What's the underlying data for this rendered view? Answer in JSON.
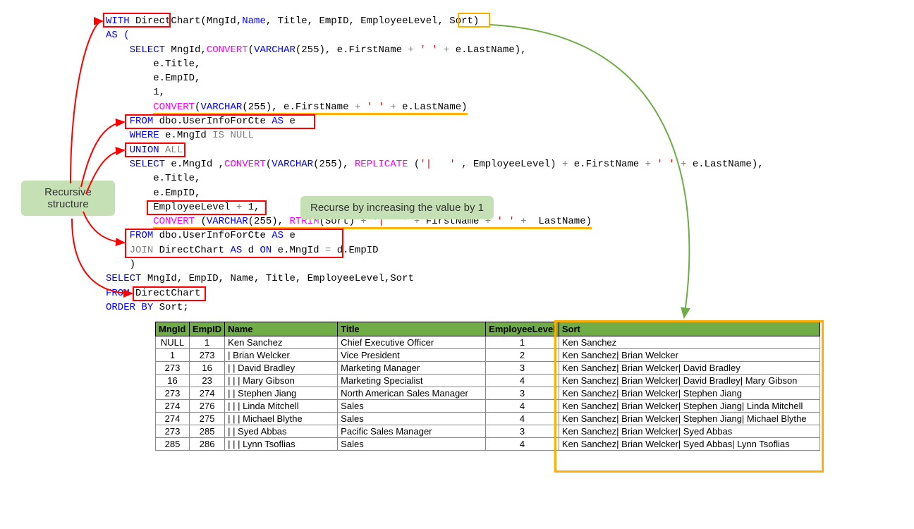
{
  "labels": {
    "recursive_structure": "Recursive\nstructure",
    "recurse_increase": "Recurse by increasing the value by 1"
  },
  "code": {
    "l1_with": "WITH",
    "l1_cte_decl": " DirectChart(",
    "l1_cols": [
      "MngId",
      "Name",
      "Title",
      "EmpID",
      "EmployeeLevel",
      "Sort"
    ],
    "l2": "AS (",
    "l3_select": "SELECT",
    "l3_rest_a": " MngId,",
    "l3_convert": "CONVERT",
    "l3_rest_b": "(",
    "l3_varchar": "VARCHAR",
    "l3_rest_c": "(255), e.FirstName ",
    "l3_plus1": "+",
    "l3_str1": " ' ' ",
    "l3_plus2": "+",
    "l3_rest_d": " e.LastName),",
    "l4": "e.Title,",
    "l5": "e.EmpID,",
    "l6": "1,",
    "l7_convert": "CONVERT",
    "l7_rest_a": "(",
    "l7_varchar": "VARCHAR",
    "l7_rest_b": "(255), e.FirstName ",
    "l7_plus1": "+",
    "l7_str1": " ' ' ",
    "l7_plus2": "+",
    "l7_rest_c": " e.LastName)",
    "l8_from": "FROM",
    "l8_rest": " dbo.UserInfoForCte ",
    "l8_as": "AS",
    "l8_e": " e",
    "l9_where": "WHERE",
    "l9_rest": " e.MngId ",
    "l9_is": "IS",
    "l9_null": " NULL",
    "l10_union": "UNION",
    "l10_all": " ALL",
    "l11_select": "SELECT",
    "l11_rest_a": " e.MngId ,",
    "l11_convert": "CONVERT",
    "l11_rest_b": "(",
    "l11_varchar": "VARCHAR",
    "l11_rest_c": "(255), ",
    "l11_replicate": "REPLICATE ",
    "l11_rest_d": "(",
    "l11_str1": "'|   '",
    "l11_rest_e": " , EmployeeLevel) ",
    "l11_plus1": "+",
    "l11_rest_f": " e.FirstName ",
    "l11_plus2": "+",
    "l11_str2": " ' ' ",
    "l11_plus3": "+",
    "l11_rest_g": " e.LastName),",
    "l12": "e.Title,",
    "l13": "e.EmpID,",
    "l14": "EmployeeLevel ",
    "l14_plus": "+",
    "l14_rest": " 1,",
    "l15_convert": "CONVERT ",
    "l15_rest_a": "(",
    "l15_varchar": "VARCHAR",
    "l15_rest_b": "(255), ",
    "l15_rtrim": "RTRIM",
    "l15_rest_c": "(Sort) ",
    "l15_plus1": "+",
    "l15_str1": " '|   ' ",
    "l15_plus2": "+",
    "l15_rest_d": " FirstName ",
    "l15_plus3": "+",
    "l15_str2": " ' ' ",
    "l15_plus4": "+",
    "l15_rest_e": "  LastName)",
    "l16_from": "FROM",
    "l16_rest_a": " dbo.UserInfoForCte ",
    "l16_as": "AS",
    "l16_rest_b": " e",
    "l17_join": "JOIN",
    "l17_rest_a": " DirectChart ",
    "l17_as": "AS",
    "l17_rest_b": " d ",
    "l17_on": "ON",
    "l17_rest_c": " e.MngId ",
    "l17_eq": "=",
    "l17_rest_d": " d.EmpID",
    "l18": ")",
    "l19_select": "SELECT",
    "l19_rest": " MngId, EmpID, Name, Title, EmployeeLevel,Sort",
    "l20_from": "FROM",
    "l20_rest": " DirectChart",
    "l21_order": "ORDER",
    "l21_by": " BY",
    "l21_rest": " Sort;"
  },
  "table": {
    "headers": [
      "MngId",
      "EmpID",
      "Name",
      "Title",
      "EmployeeLevel",
      "Sort"
    ],
    "rows": [
      {
        "mng": "NULL",
        "emp": "1",
        "name": "Ken Sanchez",
        "title": "Chief Executive Officer",
        "lvl": "1",
        "sort": "Ken Sanchez"
      },
      {
        "mng": "1",
        "emp": "273",
        "name": "|   Brian Welcker",
        "title": "Vice President",
        "lvl": "2",
        "sort": "Ken Sanchez|   Brian Welcker"
      },
      {
        "mng": "273",
        "emp": "16",
        "name": "|   |   David Bradley",
        "title": "Marketing Manager",
        "lvl": "3",
        "sort": "Ken Sanchez|   Brian Welcker|   David Bradley"
      },
      {
        "mng": "16",
        "emp": "23",
        "name": "|   |   |   Mary Gibson",
        "title": "Marketing Specialist",
        "lvl": "4",
        "sort": "Ken Sanchez|   Brian Welcker|   David Bradley|   Mary Gibson"
      },
      {
        "mng": "273",
        "emp": "274",
        "name": "|   |   Stephen Jiang",
        "title": "North American Sales Manager",
        "lvl": "3",
        "sort": "Ken Sanchez|   Brian Welcker|   Stephen Jiang"
      },
      {
        "mng": "274",
        "emp": "276",
        "name": "|   |   |   Linda Mitchell",
        "title": "Sales",
        "lvl": "4",
        "sort": "Ken Sanchez|   Brian Welcker|   Stephen Jiang|   Linda Mitchell"
      },
      {
        "mng": "274",
        "emp": "275",
        "name": "|   |   |   Michael Blythe",
        "title": "Sales",
        "lvl": "4",
        "sort": "Ken Sanchez|   Brian Welcker|   Stephen Jiang|   Michael Blythe"
      },
      {
        "mng": "273",
        "emp": "285",
        "name": "|   |   Syed Abbas",
        "title": "Pacific Sales Manager",
        "lvl": "3",
        "sort": "Ken Sanchez|   Brian Welcker|   Syed Abbas"
      },
      {
        "mng": "285",
        "emp": "286",
        "name": "|   |   |   Lynn Tsoflias",
        "title": "Sales",
        "lvl": "4",
        "sort": "Ken Sanchez|   Brian Welcker|   Syed Abbas|   Lynn Tsoflias"
      }
    ]
  }
}
